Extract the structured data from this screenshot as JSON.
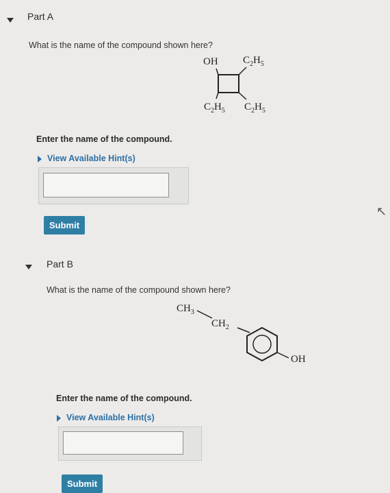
{
  "part_a": {
    "label": "Part A",
    "question": "What is the name of the compound shown here?",
    "structure": {
      "oh": "OH",
      "c2h5": "C2H5"
    },
    "prompt": "Enter the name of the compound.",
    "hint": "View Available Hint(s)",
    "answer_value": "",
    "submit": "Submit"
  },
  "part_b": {
    "label": "Part B",
    "question": "What is the name of the compound shown here?",
    "structure": {
      "ch3": "CH3",
      "ch2": "CH2",
      "oh": "OH"
    },
    "prompt": "Enter the name of the compound.",
    "hint": "View Available Hint(s)",
    "answer_value": "",
    "submit": "Submit"
  }
}
